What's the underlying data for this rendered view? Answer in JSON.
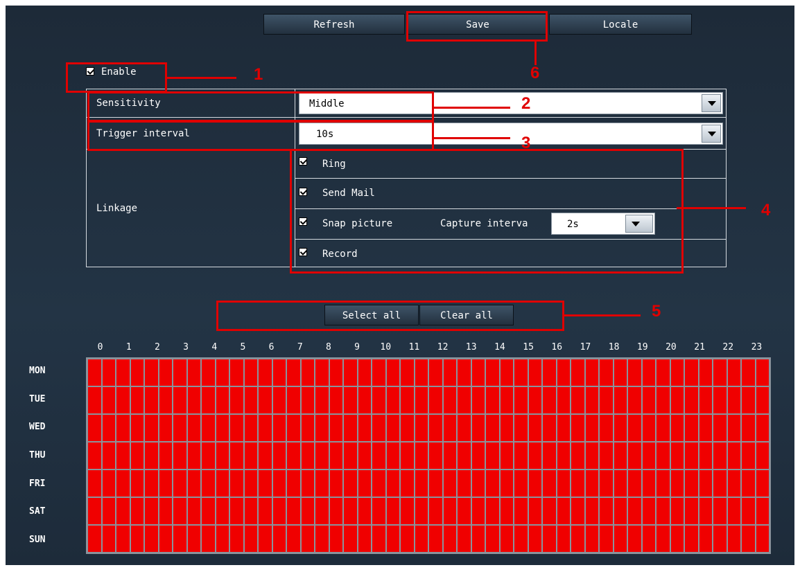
{
  "toolbar": {
    "refresh_label": "Refresh",
    "save_label": "Save",
    "locale_label": "Locale"
  },
  "enable": {
    "label": "Enable",
    "checked": true
  },
  "form": {
    "sensitivity_label": "Sensitivity",
    "sensitivity_value": "Middle",
    "trigger_label": "Trigger interval",
    "trigger_value": "10s",
    "linkage_label": "Linkage",
    "linkage": {
      "ring": "Ring",
      "send_mail": "Send Mail",
      "snap_picture": "Snap picture",
      "capture_interval_label": "Capture interva",
      "capture_interval_value": "2s",
      "record": "Record"
    }
  },
  "schedule": {
    "select_all": "Select all",
    "clear_all": "Clear all",
    "hours": [
      "0",
      "1",
      "2",
      "3",
      "4",
      "5",
      "6",
      "7",
      "8",
      "9",
      "10",
      "11",
      "12",
      "13",
      "14",
      "15",
      "16",
      "17",
      "18",
      "19",
      "20",
      "21",
      "22",
      "23"
    ],
    "days": [
      "MON",
      "TUE",
      "WED",
      "THU",
      "FRI",
      "SAT",
      "SUN"
    ],
    "all_selected": true
  },
  "callouts": [
    "1",
    "2",
    "3",
    "4",
    "5",
    "6"
  ],
  "colors": {
    "accent": "#e00000",
    "background": "#233445",
    "cell_selected": "#f00000"
  }
}
